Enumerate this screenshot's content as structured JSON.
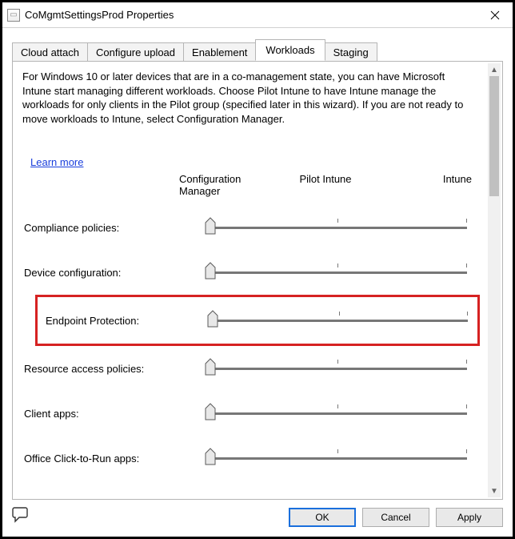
{
  "window": {
    "title": "CoMgmtSettingsProd Properties"
  },
  "tabs": [
    {
      "label": "Cloud attach",
      "active": false
    },
    {
      "label": "Configure upload",
      "active": false
    },
    {
      "label": "Enablement",
      "active": false
    },
    {
      "label": "Workloads",
      "active": true
    },
    {
      "label": "Staging",
      "active": false
    }
  ],
  "panel": {
    "description": "For Windows 10 or later devices that are in a co-management state, you can have Microsoft Intune start managing different workloads. Choose Pilot Intune to have Intune manage the workloads for only clients in the Pilot group (specified later in this wizard). If you are not ready to move workloads to Intune, select Configuration Manager.",
    "learn_more": "Learn more",
    "columns": {
      "c1": "Configuration Manager",
      "c2": "Pilot Intune",
      "c3": "Intune"
    },
    "workloads": [
      {
        "label": "Compliance policies:",
        "position": 0,
        "highlight": false
      },
      {
        "label": "Device configuration:",
        "position": 0,
        "highlight": false
      },
      {
        "label": "Endpoint Protection:",
        "position": 0,
        "highlight": true
      },
      {
        "label": "Resource access policies:",
        "position": 0,
        "highlight": false
      },
      {
        "label": "Client apps:",
        "position": 0,
        "highlight": false
      },
      {
        "label": "Office Click-to-Run apps:",
        "position": 0,
        "highlight": false
      }
    ]
  },
  "buttons": {
    "ok": "OK",
    "cancel": "Cancel",
    "apply": "Apply"
  }
}
